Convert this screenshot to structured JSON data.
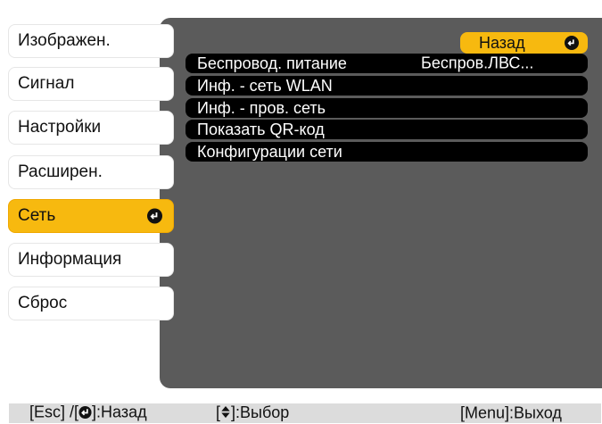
{
  "nav": {
    "items": [
      {
        "label": "Изображен."
      },
      {
        "label": "Сигнал"
      },
      {
        "label": "Настройки"
      },
      {
        "label": "Расширен."
      },
      {
        "label": "Сеть",
        "active": true
      },
      {
        "label": "Информация"
      },
      {
        "label": "Сброс"
      }
    ]
  },
  "submenu": {
    "back_label": "Назад",
    "rows": [
      {
        "label": "Беспровод. питание",
        "value": "Беспров.ЛВС..."
      },
      {
        "label": "Инф. - сеть WLAN"
      },
      {
        "label": "Инф. - пров. сеть"
      },
      {
        "label": "Показать QR-код"
      },
      {
        "label": "Конфигурации сети"
      }
    ]
  },
  "footer": {
    "back_hint_prefix": "[Esc] /[",
    "back_hint_suffix": "]:Назад",
    "select_hint_prefix": "[",
    "select_hint_suffix": "]:Выбор",
    "exit_hint": "[Menu]:Выход"
  },
  "colors": {
    "accent": "#f7b90f",
    "panel": "#5b5b5b",
    "row": "#000000",
    "footer": "#dcdcdc"
  }
}
